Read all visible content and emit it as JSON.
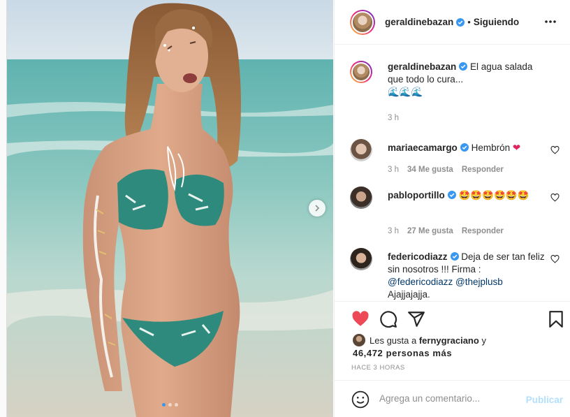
{
  "post": {
    "username": "geraldinebazan",
    "follow_separator": "•",
    "follow_status": "Siguiendo",
    "more_icon": "more-horizontal-icon",
    "caption": {
      "username": "geraldinebazan",
      "text": "El agua salada que todo lo cura...",
      "emojis": "🌊🌊🌊",
      "time": "3 h"
    },
    "comments": [
      {
        "username": "mariaecamargo",
        "text": "Hembrón",
        "emoji": "❤",
        "time": "3 h",
        "likes": "34 Me gusta",
        "reply": "Responder"
      },
      {
        "username": "pabloportillo",
        "text": "🤩🤩🤩🤩🤩🤩",
        "time": "3 h",
        "likes": "27 Me gusta",
        "reply": "Responder"
      },
      {
        "username": "federicodiazz",
        "text": "Deja de ser tan feliz sin nosotros !!! Firma :",
        "mention1": "@federicodiazz",
        "mention2": "@thejplusb",
        "tail": "Ajajjajajja."
      }
    ],
    "likes": {
      "prefix": "Les gusta a",
      "user": "fernygraciano",
      "connector": "y",
      "count": "46,472 personas más"
    },
    "timestamp": "HACE 3 HORAS",
    "comment_placeholder": "Agrega un comentario...",
    "publish_label": "Publicar",
    "carousel": {
      "current": 1,
      "total": 3
    },
    "colors": {
      "accent": "#3897f0",
      "like": "#ed4956",
      "verified": "#3897f0",
      "publish_disabled": "#b2dffc"
    }
  }
}
